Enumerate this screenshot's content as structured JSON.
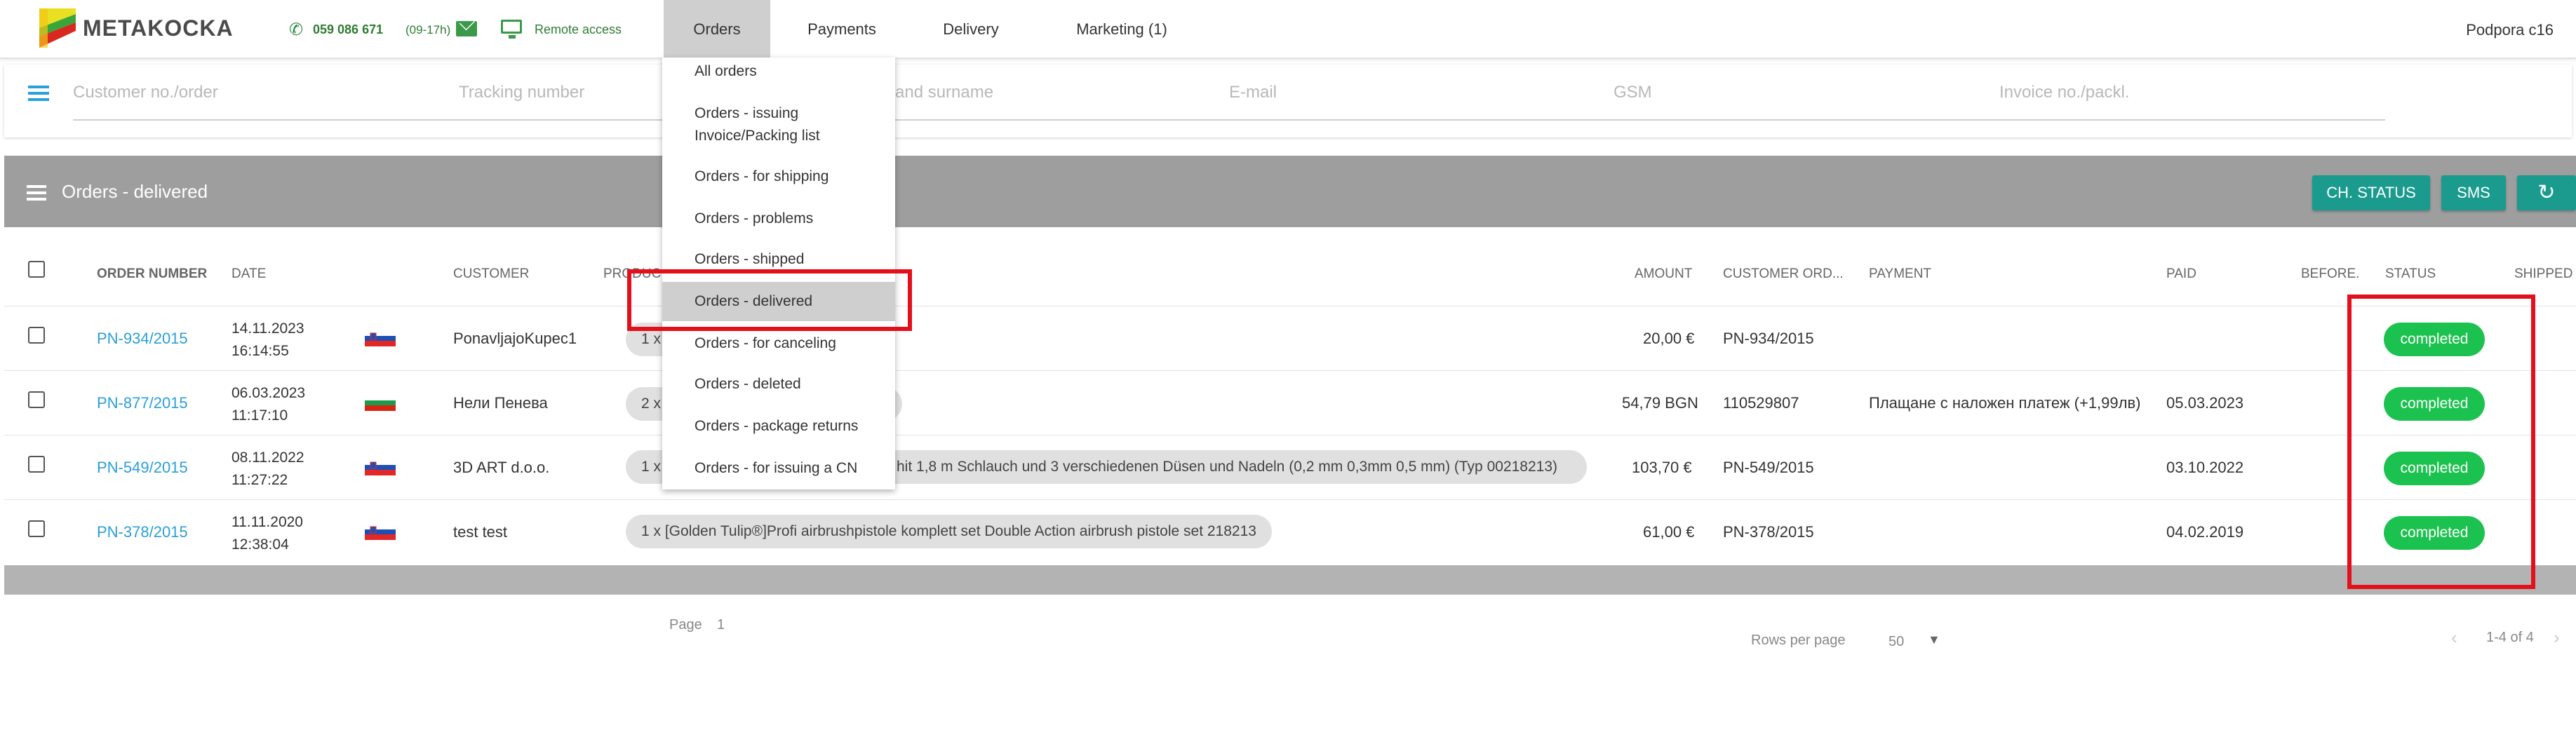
{
  "header": {
    "brand": "METAKOCKA",
    "phone": "059 086 671",
    "phone_hours": "(09-17h)",
    "remote_access": "Remote access",
    "nav": [
      "Orders",
      "Payments",
      "Delivery",
      "Marketing (1)"
    ],
    "user": "Podpora c16"
  },
  "search": {
    "fields": [
      "Customer no./order",
      "Tracking number",
      "and surname",
      "E-mail",
      "GSM",
      "Invoice no./packl."
    ]
  },
  "list": {
    "title": "Orders - delivered",
    "buttons": {
      "ch_status": "CH. STATUS",
      "sms": "SMS"
    },
    "columns": [
      "ORDER NUMBER",
      "DATE",
      "CUSTOMER",
      "PRODUC",
      "AMOUNT",
      "CUSTOMER ORD...",
      "PAYMENT",
      "PAID",
      "BEFORE.",
      "STATUS",
      "SHIPPED"
    ],
    "rows": [
      {
        "order": "PN-934/2015",
        "date": "14.11.2023",
        "time": "16:14:55",
        "flag": "SI",
        "customer": "PonavljajoKupec1",
        "product": "1 x",
        "amount": "20,00 €",
        "customer_order": "PN-934/2015",
        "payment": "",
        "paid": "",
        "status": "completed"
      },
      {
        "order": "PN-877/2015",
        "date": "06.03.2023",
        "time": "11:17:10",
        "flag": "BG",
        "customer": "Нели Пенева",
        "product": "2 x",
        "amount": "54,79 BGN",
        "customer_order": "110529807",
        "payment": "Плащане с наложен платеж (+1,99лв)",
        "paid": "05.03.2023",
        "status": "completed"
      },
      {
        "order": "PN-549/2015",
        "date": "08.11.2022",
        "time": "11:27:22",
        "flag": "SI",
        "customer": "3D ART d.o.o.",
        "product": "1 x",
        "product_tail": "hit 1,8 m Schlauch und 3 verschiedenen Düsen und Nadeln (0,2 mm 0,3mm 0,5 mm) (Typ 00218213)",
        "amount": "103,70 €",
        "customer_order": "PN-549/2015",
        "payment": "",
        "paid": "03.10.2022",
        "status": "completed"
      },
      {
        "order": "PN-378/2015",
        "date": "11.11.2020",
        "time": "12:38:04",
        "flag": "SI",
        "customer": "test test",
        "product": "1 x [Golden Tulip®]Profi airbrushpistole komplett set Double Action airbrush pistole set 218213",
        "amount": "61,00 €",
        "customer_order": "PN-378/2015",
        "payment": "",
        "paid": "04.02.2019",
        "status": "completed"
      }
    ]
  },
  "footer": {
    "page_label": "Page",
    "page_value": "1",
    "rows_per_page_label": "Rows per page",
    "rows_per_page_value": "50",
    "range": "1-4 of 4"
  },
  "dropdown": {
    "items": [
      "All orders",
      "Orders - issuing",
      "Invoice/Packing list",
      "Orders - for shipping",
      "Orders - problems",
      "Orders - shipped",
      "Orders - delivered",
      "Orders - for canceling",
      "Orders - deleted",
      "Orders - package returns",
      "Orders - for issuing a CN"
    ],
    "selected": "Orders - delivered"
  },
  "colors": {
    "accent": "#2b9fd8",
    "teal": "#1a9b8e",
    "status_green": "#1cc24f",
    "highlight_red": "#e3101b"
  },
  "icons": [
    "logo-icon",
    "phone-icon",
    "mail-icon",
    "monitor-icon",
    "list-icon",
    "refresh-icon",
    "chevron-left-icon",
    "chevron-right-icon",
    "dropdown-arrow-icon"
  ]
}
